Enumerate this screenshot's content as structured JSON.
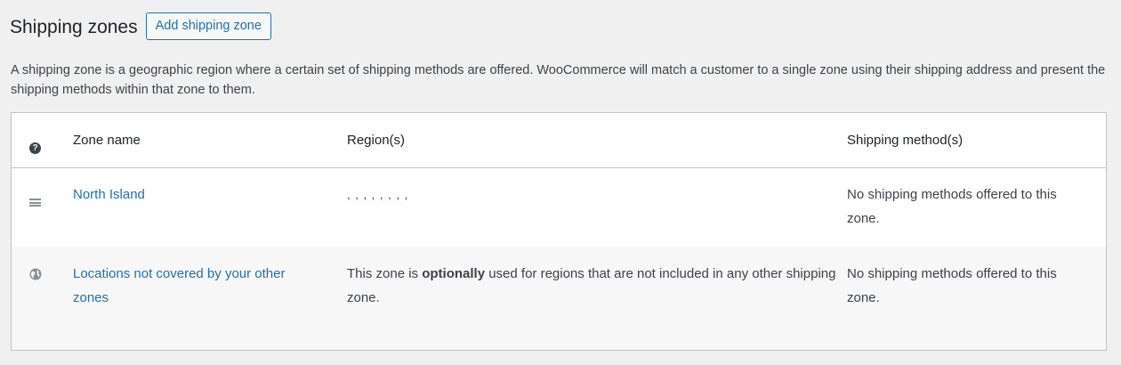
{
  "header": {
    "title": "Shipping zones",
    "add_button": "Add shipping zone"
  },
  "description": "A shipping zone is a geographic region where a certain set of shipping methods are offered. WooCommerce will match a customer to a single zone using their shipping address and present the shipping methods within that zone to them.",
  "table": {
    "columns": {
      "icon": "?",
      "name": "Zone name",
      "regions": "Region(s)",
      "methods": "Shipping method(s)"
    },
    "rows": [
      {
        "name": "North Island",
        "regions": ", , , , , , , ,",
        "methods": "No shipping methods offered to this zone.",
        "icon": "drag-handle-icon"
      },
      {
        "name": "Locations not covered by your other zones",
        "regions_pre": "This zone is ",
        "regions_bold": "optionally",
        "regions_post": " used for regions that are not included in any other shipping zone.",
        "methods": "No shipping methods offered to this zone.",
        "icon": "globe-icon"
      }
    ]
  },
  "colors": {
    "link": "#2271b1",
    "background": "#f0f0f1",
    "border": "#c3c4c7"
  }
}
